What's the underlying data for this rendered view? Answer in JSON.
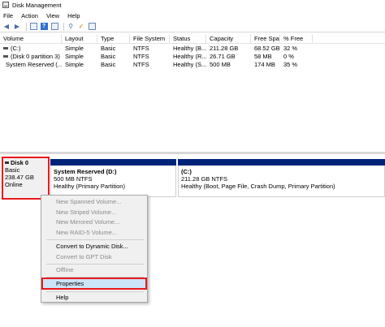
{
  "window": {
    "title": "Disk Management"
  },
  "menu": [
    "File",
    "Action",
    "View",
    "Help"
  ],
  "toolbar_icons": [
    "back-arrow-icon",
    "forward-arrow-icon",
    "volume-list-icon",
    "help-icon",
    "graphic-view-icon",
    "key-icon",
    "checklist-icon",
    "properties-icon"
  ],
  "volume_table": {
    "headers": [
      "Volume",
      "Layout",
      "Type",
      "File System",
      "Status",
      "Capacity",
      "Free Spa...",
      "% Free"
    ],
    "rows": [
      [
        "(C:)",
        "Simple",
        "Basic",
        "NTFS",
        "Healthy (B...",
        "211.28 GB",
        "68.52 GB",
        "32 %"
      ],
      [
        "(Disk 0 partition 3)",
        "Simple",
        "Basic",
        "NTFS",
        "Healthy (R...",
        "26.71 GB",
        "58 MB",
        "0 %"
      ],
      [
        "System Reserved (...",
        "Simple",
        "Basic",
        "NTFS",
        "Healthy (S...",
        "500 MB",
        "174 MB",
        "35 %"
      ]
    ]
  },
  "disk": {
    "name": "Disk 0",
    "type": "Basic",
    "size": "238.47 GB",
    "status": "Online"
  },
  "partitions": [
    {
      "label": "System Reserved (D:)",
      "size": "500 MB NTFS",
      "status": "Healthy (Primary Partition)"
    },
    {
      "label": "(C:)",
      "size": "211.28 GB NTFS",
      "status": "Healthy (Boot, Page File, Crash Dump, Primary Partition)"
    }
  ],
  "context_menu": {
    "items": [
      {
        "label": "New Spanned Volume...",
        "enabled": false
      },
      {
        "label": "New Striped Volume...",
        "enabled": false
      },
      {
        "label": "New Mirrored Volume...",
        "enabled": false
      },
      {
        "label": "New RAID-5 Volume...",
        "enabled": false
      },
      {
        "label": "Convert to Dynamic Disk...",
        "enabled": true
      },
      {
        "label": "Convert to GPT Disk",
        "enabled": false
      },
      {
        "label": "Offline",
        "enabled": false
      },
      {
        "label": "Properties",
        "enabled": true,
        "highlighted": true
      },
      {
        "label": "Help",
        "enabled": true
      }
    ]
  },
  "colors": {
    "partition_bar": "#00237a",
    "highlight_box": "#e8191c",
    "menu_highlight": "#cce4f7"
  }
}
